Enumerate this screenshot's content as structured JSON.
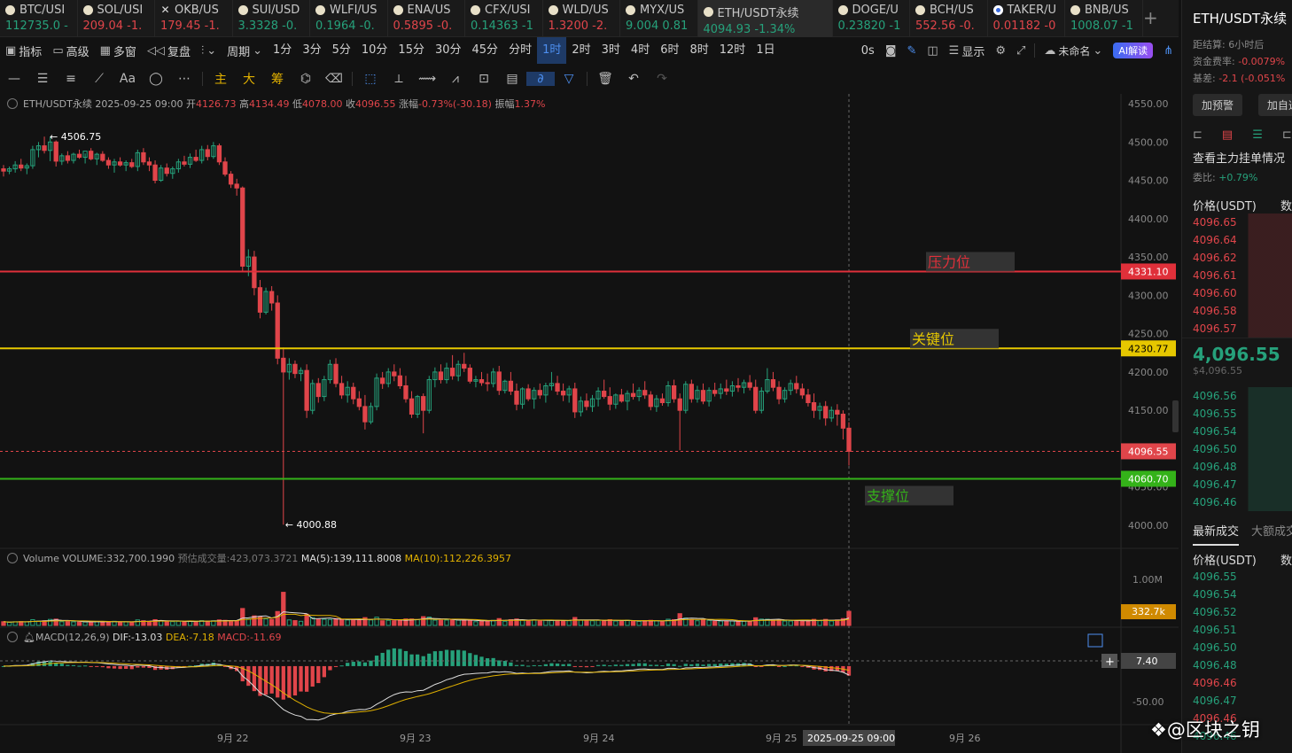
{
  "tickers": [
    {
      "name": "BTC/USI",
      "price": "112735.0",
      "chg": "-",
      "dir": "up",
      "icon": "dot"
    },
    {
      "name": "SOL/USI",
      "price": "209.04",
      "chg": "-1.",
      "dir": "dn",
      "icon": "dot"
    },
    {
      "name": "OKB/US",
      "price": "179.45",
      "chg": "-1.",
      "dir": "dn",
      "icon": "x"
    },
    {
      "name": "SUI/USD",
      "price": "3.3328",
      "chg": "-0.",
      "dir": "up",
      "icon": "dot"
    },
    {
      "name": "WLFI/US",
      "price": "0.1964",
      "chg": "-0.",
      "dir": "up",
      "icon": "dot"
    },
    {
      "name": "ENA/US",
      "price": "0.5895",
      "chg": "-0.",
      "dir": "dn",
      "icon": "dot"
    },
    {
      "name": "CFX/USI",
      "price": "0.14363",
      "chg": "-1",
      "dir": "up",
      "icon": "dot"
    },
    {
      "name": "WLD/US",
      "price": "1.3200",
      "chg": "-2.",
      "dir": "dn",
      "icon": "dot"
    },
    {
      "name": "MYX/US",
      "price": "9.004",
      "chg": "0.81",
      "dir": "up",
      "icon": "dot"
    },
    {
      "name": "ETH/USDT永续",
      "price": "4094.93",
      "chg": "-1.34%",
      "dir": "up",
      "icon": "dot",
      "active": true
    },
    {
      "name": "DOGE/U",
      "price": "0.23820",
      "chg": "-1",
      "dir": "up",
      "icon": "dot"
    },
    {
      "name": "BCH/US",
      "price": "552.56",
      "chg": "-0.",
      "dir": "dn",
      "icon": "dot"
    },
    {
      "name": "TAKER/U",
      "price": "0.01182",
      "chg": "-0",
      "dir": "dn",
      "icon": "b"
    },
    {
      "name": "BNB/US",
      "price": "1008.07",
      "chg": "-1",
      "dir": "up",
      "icon": "dot"
    }
  ],
  "toolbar": {
    "indicators": "指标",
    "advanced": "高级",
    "multi": "多窗",
    "replay": "复盘",
    "period": "周期",
    "periods": [
      "1分",
      "3分",
      "5分",
      "10分",
      "15分",
      "30分",
      "45分",
      "分时",
      "1时",
      "2时",
      "3时",
      "4时",
      "6时",
      "8时",
      "12时",
      "1日"
    ],
    "selected_period": "1时",
    "zero_s": "0s",
    "display": "显示",
    "unnamed": "未命名",
    "ai": "AI解读"
  },
  "drawing_tools": [
    "main",
    "big",
    "chip"
  ],
  "drawing_labels": {
    "main": "主",
    "big": "大",
    "chip": "筹",
    "text": "Aa"
  },
  "ohlc": {
    "symbol": "ETH/USDT永续",
    "date": "2025-09-25 09:00",
    "open_label": "开",
    "open": "4126.73",
    "high_label": "高",
    "high": "4134.49",
    "low_label": "低",
    "low": "4078.00",
    "close_label": "收",
    "close": "4096.55",
    "change_label": "涨幅",
    "change": "-0.73%(-30.18)",
    "amp_label": "振幅",
    "amp": "1.37%"
  },
  "volume_header": {
    "label": "Volume",
    "volume": "VOLUME:332,700.1990",
    "est": "预估成交量:423,073.3721",
    "ma5": "MA(5):139,111.8008",
    "ma10": "MA(10):112,226.3957"
  },
  "macd_header": {
    "label": "MACD(12,26,9)",
    "dif": "DIF:-13.03",
    "dea": "DEA:-7.18",
    "macd": "MACD:-11.69"
  },
  "levels": {
    "resistance": {
      "label": "压力位",
      "value": "4331.10",
      "price": 4331.1,
      "color": "#e0303a"
    },
    "key": {
      "label": "关键位",
      "value": "4230.77",
      "price": 4230.77,
      "color": "#e6c700"
    },
    "support": {
      "label": "支撑位",
      "value": "4060.70",
      "price": 4060.7,
      "color": "#34b219"
    },
    "last": {
      "value": "4096.55",
      "price": 4096.55
    }
  },
  "annotations": {
    "high": "4506.75",
    "low": "4000.88"
  },
  "price_axis": [
    "4550.00",
    "4500.00",
    "4450.00",
    "4400.00",
    "4350.00",
    "4300.00",
    "4250.00",
    "4200.00",
    "4150.00",
    "4100.00",
    "4050.00",
    "4000.00"
  ],
  "vol_axis": {
    "top": "1.00M",
    "current": "332.7k"
  },
  "macd_axis": {
    "top": "7.40",
    "bottom": "-50.00"
  },
  "time_axis": [
    "9月 22",
    "9月 23",
    "9月 24",
    "9月 25",
    "9月 26"
  ],
  "crosshair_time": "2025-09-25 09:00",
  "side": {
    "title": "ETH/USDT永续",
    "settle_label": "距结算:",
    "settle": "6小时后",
    "funding_label": "资金费率:",
    "funding": "-0.0079%",
    "basis_label": "基差:",
    "basis": "-2.1 (-0.051%",
    "btn_alert": "加预警",
    "btn_add": "加自选",
    "orderbook_title": "查看主力挂单情况",
    "ratio_label": "委比:",
    "ratio": "+0.79%",
    "price_header": "价格(USDT)",
    "qty_header": "数",
    "asks": [
      "4096.65",
      "4096.64",
      "4096.62",
      "4096.61",
      "4096.60",
      "4096.58",
      "4096.57"
    ],
    "last_price": "4,096.55",
    "last_sub": "$4,096.55",
    "bids": [
      "4096.56",
      "4096.55",
      "4096.54",
      "4096.50",
      "4096.48",
      "4096.47",
      "4096.46"
    ],
    "trades_tab": "最新成交",
    "big_tab": "大额成交",
    "trades": [
      {
        "p": "4096.55",
        "d": "up"
      },
      {
        "p": "4096.54",
        "d": "up"
      },
      {
        "p": "4096.52",
        "d": "up"
      },
      {
        "p": "4096.51",
        "d": "up"
      },
      {
        "p": "4096.50",
        "d": "up"
      },
      {
        "p": "4096.48",
        "d": "up"
      },
      {
        "p": "4096.46",
        "d": "dn"
      },
      {
        "p": "4096.47",
        "d": "up"
      },
      {
        "p": "4096.46",
        "d": "dn"
      },
      {
        "p": "4096.46",
        "d": "up"
      }
    ]
  },
  "watermark": "@区块之钥",
  "chart_data": {
    "type": "candlestick",
    "title": "ETH/USDT永续",
    "interval": "1时",
    "ylim": [
      4000,
      4550
    ],
    "candles": [
      [
        4465,
        4470,
        4455,
        4462
      ],
      [
        4462,
        4468,
        4458,
        4465
      ],
      [
        4465,
        4475,
        4460,
        4470
      ],
      [
        4470,
        4478,
        4462,
        4466
      ],
      [
        4466,
        4472,
        4458,
        4469
      ],
      [
        4469,
        4495,
        4465,
        4490
      ],
      [
        4490,
        4500,
        4480,
        4495
      ],
      [
        4495,
        4507,
        4485,
        4489
      ],
      [
        4489,
        4506.75,
        4475,
        4500
      ],
      [
        4500,
        4502,
        4468,
        4475
      ],
      [
        4475,
        4485,
        4470,
        4482
      ],
      [
        4482,
        4488,
        4472,
        4476
      ],
      [
        4476,
        4486,
        4472,
        4484
      ],
      [
        4484,
        4490,
        4478,
        4480
      ],
      [
        4480,
        4485,
        4472,
        4488
      ],
      [
        4488,
        4492,
        4476,
        4478
      ],
      [
        4478,
        4486,
        4470,
        4484
      ],
      [
        4484,
        4488,
        4474,
        4476
      ],
      [
        4476,
        4480,
        4465,
        4470
      ],
      [
        4470,
        4478,
        4460,
        4474
      ],
      [
        4474,
        4480,
        4468,
        4470
      ],
      [
        4470,
        4476,
        4462,
        4473
      ],
      [
        4473,
        4478,
        4466,
        4468
      ],
      [
        4468,
        4490,
        4462,
        4486
      ],
      [
        4486,
        4492,
        4470,
        4474
      ],
      [
        4474,
        4480,
        4462,
        4470
      ],
      [
        4470,
        4476,
        4446,
        4450
      ],
      [
        4450,
        4470,
        4448,
        4466
      ],
      [
        4466,
        4472,
        4455,
        4459
      ],
      [
        4459,
        4468,
        4452,
        4465
      ],
      [
        4465,
        4478,
        4460,
        4474
      ],
      [
        4474,
        4482,
        4468,
        4471
      ],
      [
        4471,
        4485,
        4466,
        4480
      ],
      [
        4480,
        4490,
        4474,
        4476
      ],
      [
        4476,
        4495,
        4472,
        4490
      ],
      [
        4490,
        4496,
        4476,
        4481
      ],
      [
        4481,
        4500,
        4478,
        4495
      ],
      [
        4495,
        4498,
        4470,
        4474
      ],
      [
        4474,
        4480,
        4455,
        4458
      ],
      [
        4458,
        4462,
        4440,
        4445
      ],
      [
        4445,
        4452,
        4430,
        4440
      ],
      [
        4440,
        4442,
        4330,
        4338
      ],
      [
        4338,
        4360,
        4325,
        4350
      ],
      [
        4350,
        4358,
        4300,
        4310
      ],
      [
        4310,
        4320,
        4270,
        4278
      ],
      [
        4278,
        4310,
        4275,
        4305
      ],
      [
        4305,
        4312,
        4280,
        4290
      ],
      [
        4290,
        4300,
        4210,
        4218
      ],
      [
        4218,
        4232,
        4000.88,
        4200
      ],
      [
        4200,
        4218,
        4190,
        4210
      ],
      [
        4210,
        4215,
        4192,
        4198
      ],
      [
        4198,
        4206,
        4188,
        4202
      ],
      [
        4202,
        4210,
        4140,
        4150
      ],
      [
        4150,
        4190,
        4145,
        4185
      ],
      [
        4185,
        4192,
        4160,
        4168
      ],
      [
        4168,
        4195,
        4162,
        4190
      ],
      [
        4190,
        4216,
        4185,
        4210
      ],
      [
        4210,
        4218,
        4180,
        4185
      ],
      [
        4185,
        4195,
        4165,
        4170
      ],
      [
        4170,
        4188,
        4160,
        4180
      ],
      [
        4180,
        4186,
        4158,
        4165
      ],
      [
        4165,
        4175,
        4150,
        4155
      ],
      [
        4155,
        4170,
        4125,
        4135
      ],
      [
        4135,
        4160,
        4132,
        4155
      ],
      [
        4155,
        4198,
        4150,
        4192
      ],
      [
        4192,
        4200,
        4178,
        4185
      ],
      [
        4185,
        4205,
        4180,
        4200
      ],
      [
        4200,
        4210,
        4188,
        4195
      ],
      [
        4195,
        4205,
        4178,
        4182
      ],
      [
        4182,
        4195,
        4160,
        4165
      ],
      [
        4165,
        4175,
        4140,
        4145
      ],
      [
        4145,
        4170,
        4140,
        4168
      ],
      [
        4168,
        4172,
        4120,
        4150
      ],
      [
        4150,
        4195,
        4146,
        4190
      ],
      [
        4190,
        4206,
        4180,
        4200
      ],
      [
        4200,
        4210,
        4185,
        4190
      ],
      [
        4190,
        4212,
        4185,
        4205
      ],
      [
        4205,
        4222,
        4190,
        4195
      ],
      [
        4195,
        4215,
        4188,
        4210
      ],
      [
        4210,
        4225,
        4200,
        4205
      ],
      [
        4205,
        4210,
        4185,
        4188
      ],
      [
        4188,
        4195,
        4180,
        4190
      ],
      [
        4190,
        4200,
        4182,
        4186
      ],
      [
        4186,
        4198,
        4175,
        4185
      ],
      [
        4185,
        4205,
        4180,
        4200
      ],
      [
        4200,
        4208,
        4170,
        4176
      ],
      [
        4176,
        4190,
        4172,
        4188
      ],
      [
        4188,
        4200,
        4170,
        4175
      ],
      [
        4175,
        4185,
        4150,
        4158
      ],
      [
        4158,
        4180,
        4152,
        4178
      ],
      [
        4178,
        4184,
        4162,
        4165
      ],
      [
        4165,
        4180,
        4152,
        4176
      ],
      [
        4176,
        4185,
        4165,
        4170
      ],
      [
        4170,
        4186,
        4160,
        4182
      ],
      [
        4182,
        4200,
        4176,
        4185
      ],
      [
        4185,
        4195,
        4170,
        4175
      ],
      [
        4175,
        4185,
        4162,
        4170
      ],
      [
        4170,
        4182,
        4160,
        4178
      ],
      [
        4178,
        4186,
        4140,
        4148
      ],
      [
        4148,
        4168,
        4142,
        4162
      ],
      [
        4162,
        4172,
        4150,
        4155
      ],
      [
        4155,
        4170,
        4148,
        4165
      ],
      [
        4165,
        4180,
        4155,
        4175
      ],
      [
        4175,
        4190,
        4165,
        4168
      ],
      [
        4168,
        4180,
        4150,
        4158
      ],
      [
        4158,
        4172,
        4152,
        4170
      ],
      [
        4170,
        4178,
        4160,
        4162
      ],
      [
        4162,
        4176,
        4150,
        4172
      ],
      [
        4172,
        4185,
        4164,
        4168
      ],
      [
        4168,
        4180,
        4162,
        4176
      ],
      [
        4176,
        4188,
        4165,
        4170
      ],
      [
        4170,
        4175,
        4150,
        4155
      ],
      [
        4155,
        4170,
        4148,
        4165
      ],
      [
        4165,
        4172,
        4156,
        4160
      ],
      [
        4160,
        4188,
        4155,
        4182
      ],
      [
        4182,
        4190,
        4160,
        4165
      ],
      [
        4165,
        4172,
        4098,
        4150
      ],
      [
        4150,
        4188,
        4146,
        4184
      ],
      [
        4184,
        4190,
        4160,
        4165
      ],
      [
        4165,
        4182,
        4160,
        4176
      ],
      [
        4176,
        4185,
        4158,
        4162
      ],
      [
        4162,
        4180,
        4155,
        4176
      ],
      [
        4176,
        4186,
        4168,
        4172
      ],
      [
        4172,
        4185,
        4165,
        4178
      ],
      [
        4178,
        4190,
        4170,
        4175
      ],
      [
        4175,
        4188,
        4168,
        4182
      ],
      [
        4182,
        4192,
        4174,
        4180
      ],
      [
        4180,
        4190,
        4172,
        4186
      ],
      [
        4186,
        4196,
        4176,
        4180
      ],
      [
        4180,
        4190,
        4146,
        4150
      ],
      [
        4150,
        4180,
        4146,
        4175
      ],
      [
        4175,
        4205,
        4172,
        4190
      ],
      [
        4190,
        4200,
        4175,
        4180
      ],
      [
        4180,
        4188,
        4158,
        4165
      ],
      [
        4165,
        4180,
        4160,
        4176
      ],
      [
        4176,
        4190,
        4170,
        4185
      ],
      [
        4185,
        4195,
        4172,
        4178
      ],
      [
        4178,
        4185,
        4165,
        4170
      ],
      [
        4170,
        4178,
        4155,
        4160
      ],
      [
        4160,
        4172,
        4140,
        4150
      ],
      [
        4150,
        4160,
        4138,
        4155
      ],
      [
        4155,
        4162,
        4130,
        4140
      ],
      [
        4140,
        4155,
        4135,
        4150
      ],
      [
        4150,
        4158,
        4130,
        4145
      ],
      [
        4145,
        4150,
        4112,
        4126.73
      ],
      [
        4126.73,
        4134.49,
        4078,
        4096.55
      ]
    ],
    "volume_max": 1000000,
    "volume_last": 332700.199,
    "macd_range": [
      -50,
      7.4
    ]
  }
}
